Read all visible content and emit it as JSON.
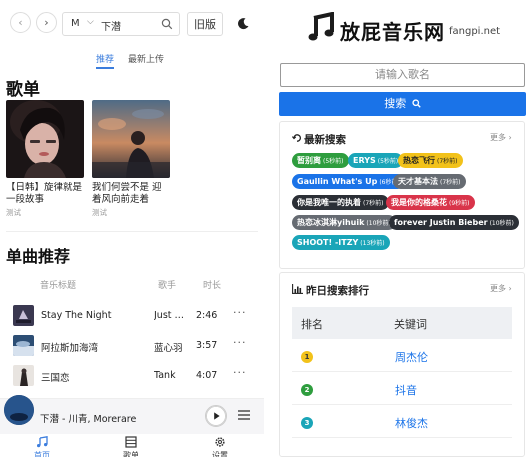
{
  "left": {
    "search": {
      "source": "M",
      "query": "下潜"
    },
    "old_version_label": "旧版",
    "tabs": [
      {
        "label": "推荐"
      },
      {
        "label": "最新上传"
      }
    ],
    "playlist_heading": "歌单",
    "playlists": [
      {
        "title": "【日韩】旋律就是一段故事",
        "sub": "测试"
      },
      {
        "title": "我们何尝不是 迎着风向前走着",
        "sub": "测试"
      }
    ],
    "songs_heading": "单曲推荐",
    "table_headers": {
      "title": "音乐标题",
      "artist": "歌手",
      "duration": "时长"
    },
    "songs": [
      {
        "name": "Stay The Night",
        "artist": "Just Ki...",
        "duration": "2:46",
        "more": "···"
      },
      {
        "name": "阿拉斯加海湾",
        "artist": "蓝心羽",
        "duration": "3:57",
        "more": "···"
      },
      {
        "name": "三国恋",
        "artist": "Tank",
        "duration": "4:07",
        "more": "···"
      }
    ],
    "now_playing": "下潜 - 川青, Morerare",
    "nav": [
      {
        "label": "首页",
        "icon": "music-note-icon"
      },
      {
        "label": "歌单",
        "icon": "list-icon"
      },
      {
        "label": "设置",
        "icon": "gear-icon"
      }
    ],
    "colors": {
      "accent": "#3b7ddd"
    }
  },
  "right": {
    "logo_text": "放屁音乐网",
    "logo_domain": "fangpi.net",
    "search_placeholder": "请输入歌名",
    "search_button": "搜索",
    "recent": {
      "title": "最新搜索",
      "more": "更多",
      "items": [
        {
          "name": "暂别离",
          "time": "(5秒前)",
          "color": "#2e9d3e",
          "text": "#fff"
        },
        {
          "name": "ERYS",
          "time": "(5秒前)",
          "color": "#1aa5b8",
          "text": "#fff"
        },
        {
          "name": "热恋飞行",
          "time": "(7秒前)",
          "color": "#f2c21a",
          "text": "#222"
        },
        {
          "name": "Gaullin What's Up",
          "time": "(6秒前)",
          "color": "#1a73e8",
          "text": "#fff"
        },
        {
          "name": "天才基本法",
          "time": "(7秒前)",
          "color": "#666b72",
          "text": "#fff"
        },
        {
          "name": "你是我唯一的执着",
          "time": "(7秒前)",
          "color": "#2b2f36",
          "text": "#fff"
        },
        {
          "name": "我是你的格桑花",
          "time": "(9秒前)",
          "color": "#d9344a",
          "text": "#fff"
        },
        {
          "name": "热恋冰淇淋yihuik",
          "time": "(10秒前)",
          "color": "#666b72",
          "text": "#fff"
        },
        {
          "name": "forever Justin Bieber",
          "time": "(10秒前)",
          "color": "#2b2f36",
          "text": "#fff"
        },
        {
          "name": "SHOOT! -ITZY",
          "time": "(13秒前)",
          "color": "#1aa5b8",
          "text": "#fff"
        }
      ]
    },
    "ranking": {
      "title": "昨日搜索排行",
      "more": "更多",
      "headers": {
        "rank": "排名",
        "keyword": "关键词"
      },
      "items": [
        {
          "rank": "1",
          "keyword": "周杰伦",
          "color": "#f2c21a"
        },
        {
          "rank": "2",
          "keyword": "抖音",
          "color": "#2e9d3e"
        },
        {
          "rank": "3",
          "keyword": "林俊杰",
          "color": "#1aa5b8"
        }
      ]
    }
  }
}
